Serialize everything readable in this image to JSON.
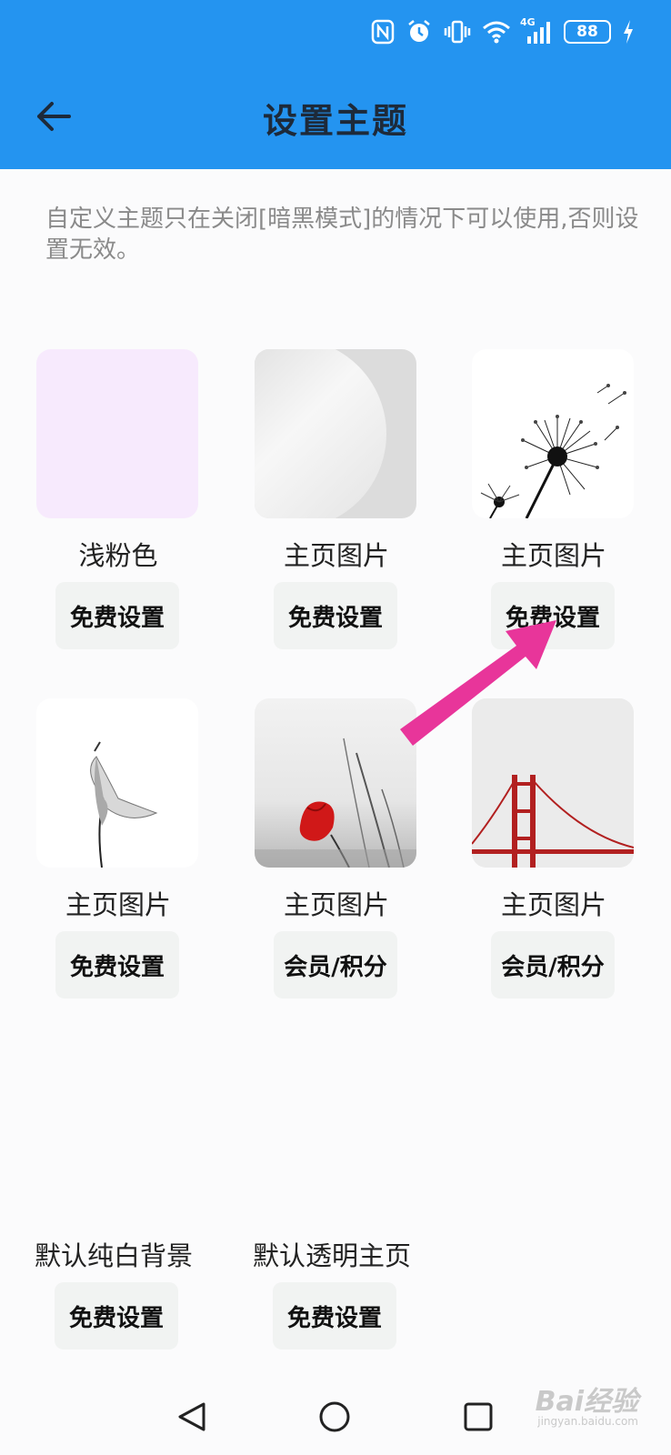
{
  "header": {
    "title": "设置主题",
    "battery": "88",
    "network": "4G",
    "accent_color": "#2494f0"
  },
  "notice": {
    "text": "自定义主题只在关闭[暗黑模式]的情况下可以使用,否则设置无效。"
  },
  "themes": [
    {
      "label": "浅粉色",
      "button": "免费设置",
      "thumb": "pink"
    },
    {
      "label": "主页图片",
      "button": "免费设置",
      "thumb": "gray-circle"
    },
    {
      "label": "主页图片",
      "button": "免费设置",
      "thumb": "dandelion"
    },
    {
      "label": "主页图片",
      "button": "免费设置",
      "thumb": "calla-lily"
    },
    {
      "label": "主页图片",
      "button": "会员/积分",
      "thumb": "red-tulip"
    },
    {
      "label": "主页图片",
      "button": "会员/积分",
      "thumb": "bridge"
    }
  ],
  "defaults": [
    {
      "label": "默认纯白背景",
      "button": "免费设置"
    },
    {
      "label": "默认透明主页",
      "button": "免费设置"
    }
  ],
  "watermark": {
    "main": "Bai经验",
    "sub": "jingyan.baidu.com"
  }
}
